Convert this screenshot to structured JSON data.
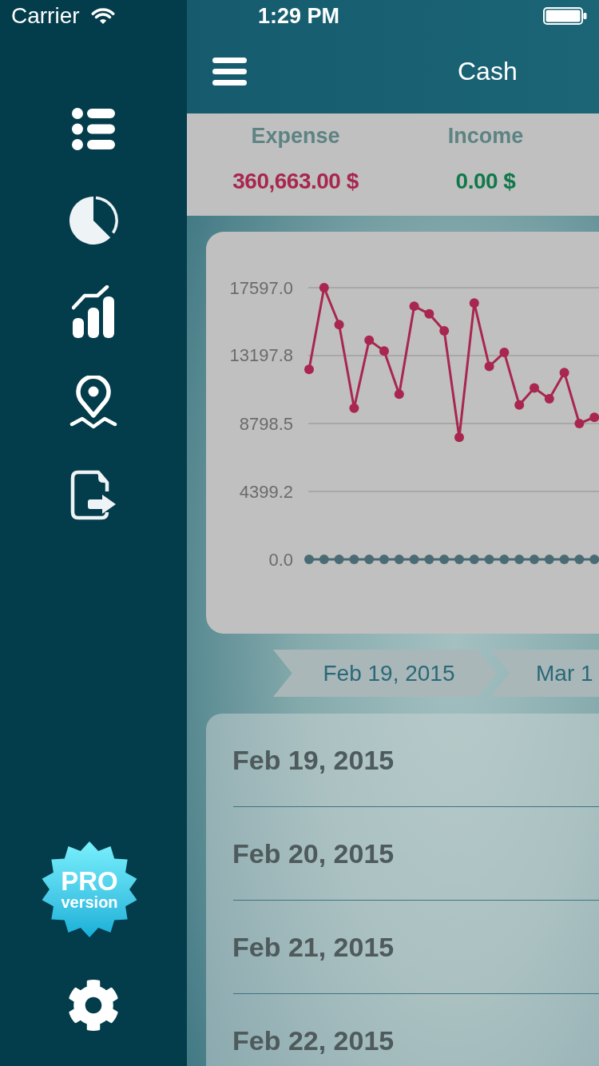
{
  "status_bar": {
    "carrier": "Carrier",
    "time": "1:29 PM"
  },
  "sidebar": {
    "pro_badge": {
      "title": "PRO",
      "subtitle": "version"
    }
  },
  "nav_bar": {
    "title": "Cash"
  },
  "summary": [
    {
      "label": "Expense",
      "value": "360,663.00 $",
      "color": "#a8264f"
    },
    {
      "label": "Income",
      "value": "0.00 $",
      "color": "#11784a"
    }
  ],
  "chart": {
    "chart_data": {
      "type": "line",
      "grid": true,
      "ylim": [
        0,
        17597
      ],
      "yticks": [
        {
          "value": 0,
          "label": "0.0"
        },
        {
          "value": 4399.2,
          "label": "4399.2"
        },
        {
          "value": 8798.5,
          "label": "8798.5"
        },
        {
          "value": 13197.8,
          "label": "13197.8"
        },
        {
          "value": 17597,
          "label": "17597.0"
        }
      ],
      "series": [
        {
          "color": "#a8264f",
          "marker": "circle",
          "values": [
            12300,
            17597,
            15200,
            9800,
            14200,
            13500,
            10700,
            16400,
            15900,
            14800,
            7900,
            16600,
            12500,
            13400,
            10000,
            11100,
            10400,
            12100,
            8800,
            9200
          ]
        },
        {
          "color": "#4b6b74",
          "marker": "circle",
          "values": [
            0,
            0,
            0,
            0,
            0,
            0,
            0,
            0,
            0,
            0,
            0,
            0,
            0,
            0,
            0,
            0,
            0,
            0,
            0,
            0
          ]
        }
      ]
    }
  },
  "period_tabs": [
    {
      "label": "Feb 19, 2015"
    },
    {
      "label": "Mar 1"
    }
  ],
  "entries": [
    {
      "date": "Feb 19, 2015"
    },
    {
      "date": "Feb 20, 2015"
    },
    {
      "date": "Feb 21, 2015"
    },
    {
      "date": "Feb 22, 2015"
    }
  ]
}
